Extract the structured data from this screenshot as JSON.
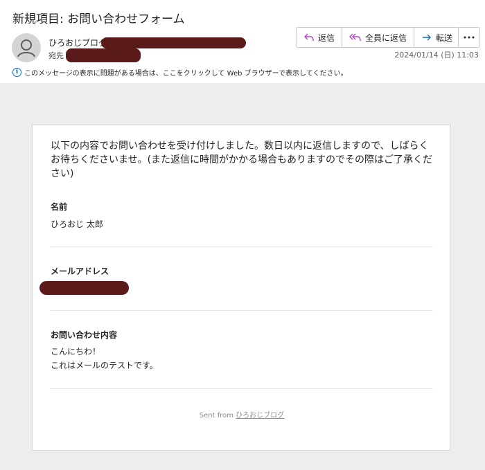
{
  "header": {
    "subject": "新規項目: お問い合わせフォーム",
    "sender_name": "ひろおじブログ",
    "to_label": "宛先",
    "timestamp": "2024/01/14 (日) 11:03",
    "info_message": "このメッセージの表示に問題がある場合は、ここをクリックして Web ブラウザーで表示してください。"
  },
  "actions": {
    "reply": "返信",
    "reply_all": "全員に返信",
    "forward": "転送",
    "more": "…"
  },
  "colors": {
    "reply_icon": "#b146c2",
    "forward_icon": "#0f6cbd",
    "redaction": "#5b1a1a"
  },
  "message": {
    "intro": "以下の内容でお問い合わせを受け付けしました。数日以内に返信しますので、しばらくお待ちくださいませ。(また返信に時間がかかる場合もありますのでその際はご了承ください)",
    "fields": [
      {
        "label": "名前",
        "value": "ひろおじ 太郎"
      },
      {
        "label": "メールアドレス",
        "value": ""
      },
      {
        "label": "お問い合わせ内容",
        "value_lines": [
          "こんにちわ！",
          "これはメールのテストです。"
        ]
      }
    ],
    "footer_prefix": "Sent from ",
    "footer_link": "ひろおじブログ"
  }
}
